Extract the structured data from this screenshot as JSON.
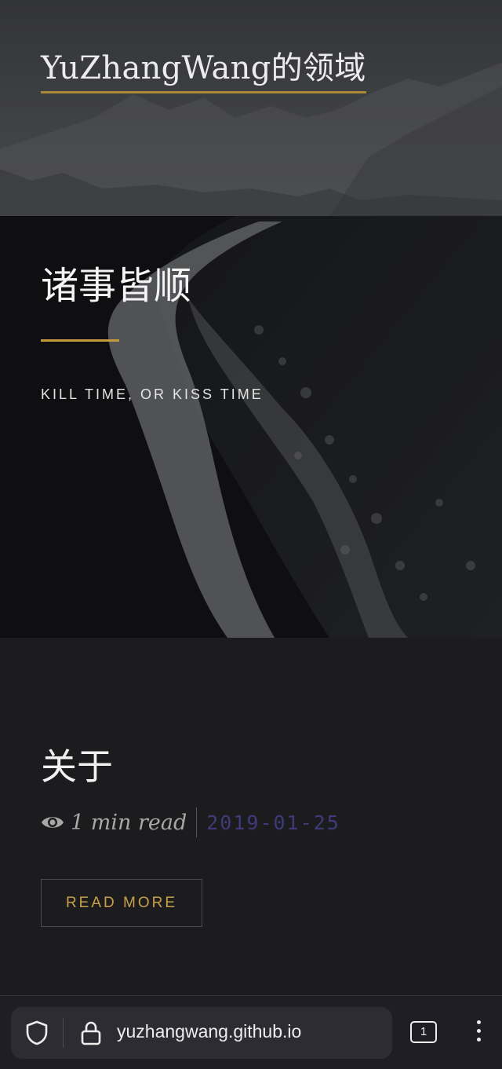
{
  "site": {
    "title": "YuZhangWang的领域"
  },
  "hero": {
    "heading": "诸事皆顺",
    "subheading": "KILL TIME, OR KISS TIME"
  },
  "post": {
    "title": "关于",
    "meta_icon": "eye-icon",
    "read_time": "1 min read",
    "date": "2019-01-25",
    "read_more_label": "READ MORE"
  },
  "browser": {
    "url": "yuzhangwang.github.io",
    "tab_count": "1",
    "icons": [
      "shield-icon",
      "lock-icon",
      "tabs-icon",
      "more-vert-icon"
    ]
  },
  "colors": {
    "accent": "#c29a3b",
    "date": "#3f3a7a",
    "background": "#1c1c1e"
  }
}
